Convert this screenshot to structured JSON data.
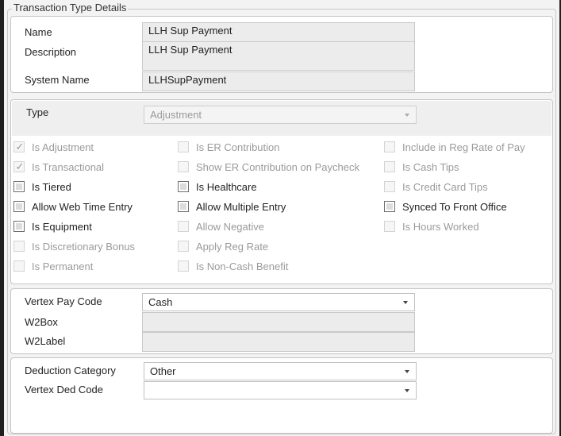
{
  "group_title": "Transaction Type Details",
  "basic": {
    "name_label": "Name",
    "name_value": "LLH Sup Payment",
    "description_label": "Description",
    "description_value": "LLH Sup Payment",
    "system_name_label": "System Name",
    "system_name_value": "LLHSupPayment"
  },
  "type_section": {
    "type_label": "Type",
    "type_value": "Adjustment",
    "checkboxes": [
      {
        "label": "Is Adjustment",
        "checked": true,
        "enabled": false
      },
      {
        "label": "Is Transactional",
        "checked": true,
        "enabled": false
      },
      {
        "label": "Is Tiered",
        "checked": false,
        "enabled": true
      },
      {
        "label": "Allow Web Time Entry",
        "checked": false,
        "enabled": true
      },
      {
        "label": "Is Equipment",
        "checked": false,
        "enabled": true
      },
      {
        "label": "Is Discretionary Bonus",
        "checked": false,
        "enabled": false
      },
      {
        "label": "Is Permanent",
        "checked": false,
        "enabled": false
      },
      {
        "label": "Is ER Contribution",
        "checked": false,
        "enabled": false
      },
      {
        "label": "Show ER Contribution on Paycheck",
        "checked": false,
        "enabled": false
      },
      {
        "label": "Is Healthcare",
        "checked": false,
        "enabled": true
      },
      {
        "label": "Allow Multiple Entry",
        "checked": false,
        "enabled": true
      },
      {
        "label": "Allow Negative",
        "checked": false,
        "enabled": false
      },
      {
        "label": "Apply Reg Rate",
        "checked": false,
        "enabled": false
      },
      {
        "label": "Is Non-Cash Benefit",
        "checked": false,
        "enabled": false
      },
      {
        "label": "Include in Reg Rate of Pay",
        "checked": false,
        "enabled": false
      },
      {
        "label": "Is Cash Tips",
        "checked": false,
        "enabled": false
      },
      {
        "label": "Is Credit Card Tips",
        "checked": false,
        "enabled": false
      },
      {
        "label": "Synced To Front Office",
        "checked": false,
        "enabled": true
      },
      {
        "label": "Is Hours Worked",
        "checked": false,
        "enabled": false
      }
    ]
  },
  "vertex": {
    "pay_code_label": "Vertex Pay Code",
    "pay_code_value": "Cash",
    "w2box_label": "W2Box",
    "w2box_value": "",
    "w2label_label": "W2Label",
    "w2label_value": ""
  },
  "deduction": {
    "category_label": "Deduction Category",
    "category_value": "Other",
    "ded_code_label": "Vertex Ded Code",
    "ded_code_value": ""
  }
}
